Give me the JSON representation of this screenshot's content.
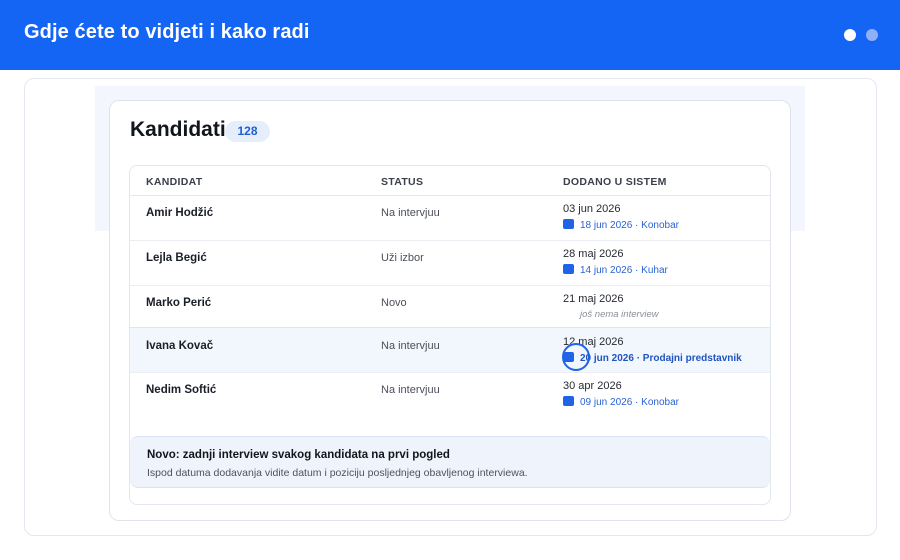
{
  "header": {
    "title": "Gdje ćete to vidjeti i kako radi"
  },
  "page": {
    "heading": "Kandidati",
    "count": "128"
  },
  "table": {
    "columns": [
      "KANDIDAT",
      "STATUS",
      "DODANO U SISTEM"
    ],
    "rows": [
      {
        "name": "Amir Hodžić",
        "status": "Na intervjuu",
        "added": "03 jun 2026",
        "interview": "18 jun 2026 · Konobar"
      },
      {
        "name": "Lejla Begić",
        "status": "Uži izbor",
        "added": "28 maj 2026",
        "interview": "14 jun 2026 · Kuhar"
      },
      {
        "name": "Marko Perić",
        "status": "Novo",
        "added": "21 maj 2026",
        "no_interview": "još nema interview"
      },
      {
        "name": "Ivana Kovač",
        "status": "Na intervjuu",
        "added": "12 maj 2026",
        "interview": "20 jun 2026 · Prodajni predstavnik"
      },
      {
        "name": "Nedim Softić",
        "status": "Na intervjuu",
        "added": "30 apr 2026",
        "interview": "09 jun 2026 · Konobar"
      }
    ]
  },
  "notice": {
    "title": "Novo: zadnji interview svakog kandidata na prvi pogled",
    "desc": "Ispod datuma dodavanja vidite datum i poziciju posljednjeg obavljenog interviewa."
  },
  "colors": {
    "brand": "#1565f5",
    "accent": "#1f63e8"
  }
}
